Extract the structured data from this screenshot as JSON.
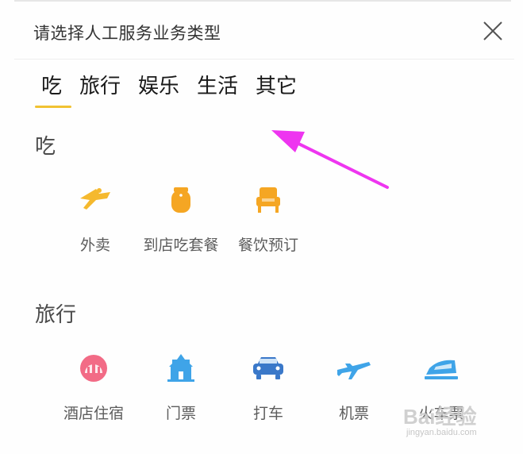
{
  "header": {
    "title": "请选择人工服务业务类型",
    "close_icon": "close-icon"
  },
  "tabs": [
    {
      "label": "吃",
      "active": true
    },
    {
      "label": "旅行",
      "active": false
    },
    {
      "label": "娱乐",
      "active": false
    },
    {
      "label": "生活",
      "active": false
    },
    {
      "label": "其它",
      "active": false
    }
  ],
  "sections": [
    {
      "title": "吃",
      "items": [
        {
          "label": "外卖",
          "icon": "takeout-icon"
        },
        {
          "label": "到店吃套餐",
          "icon": "set-meal-icon"
        },
        {
          "label": "餐饮预订",
          "icon": "restaurant-booking-icon"
        }
      ]
    },
    {
      "title": "旅行",
      "items": [
        {
          "label": "酒店住宿",
          "icon": "hotel-icon"
        },
        {
          "label": "门票",
          "icon": "ticket-icon"
        },
        {
          "label": "打车",
          "icon": "taxi-icon"
        },
        {
          "label": "机票",
          "icon": "airplane-icon"
        },
        {
          "label": "火车票",
          "icon": "train-icon"
        }
      ]
    }
  ],
  "colors": {
    "accent_underline": "#f1c232",
    "orange_icons": "#f5a623",
    "pink_icon": "#f26b86",
    "blue_icons": "#3fa4e8",
    "annotation_arrow": "#ee35f0"
  },
  "watermark": {
    "main": "Bai经验",
    "sub": "jingyan.baidu.com"
  }
}
